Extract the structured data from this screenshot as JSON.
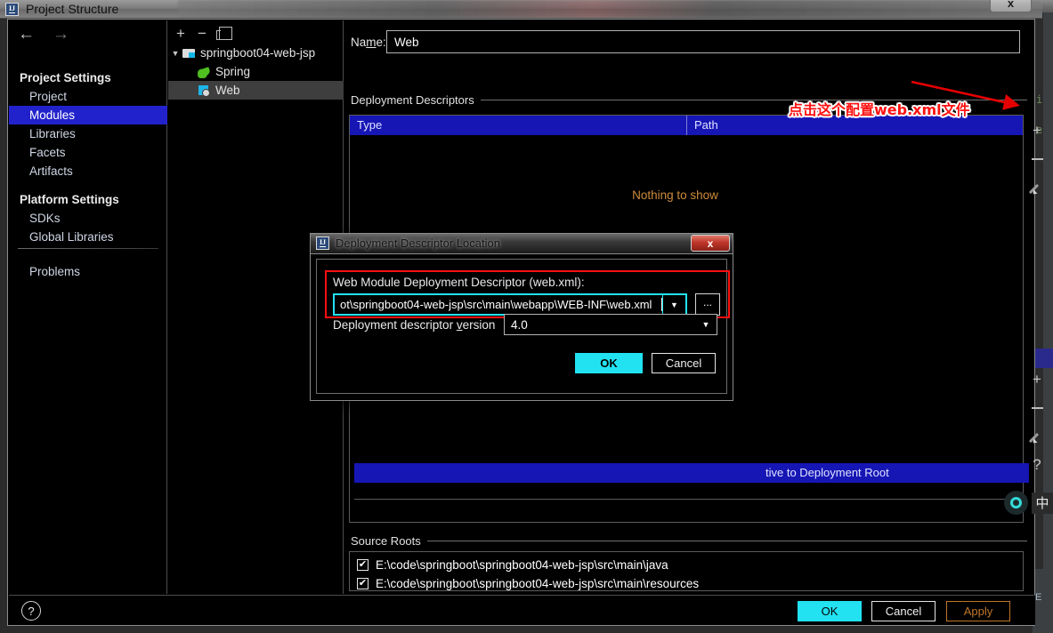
{
  "window": {
    "title": "Project Structure",
    "close_label": "x",
    "logo": "intellij-idea-logo"
  },
  "nav": {
    "back": "←",
    "forward": "→"
  },
  "sidebar": {
    "groups": [
      {
        "title": "Project Settings",
        "items": [
          {
            "label": "Project",
            "selected": false
          },
          {
            "label": "Modules",
            "selected": true
          },
          {
            "label": "Libraries",
            "selected": false
          },
          {
            "label": "Facets",
            "selected": false
          },
          {
            "label": "Artifacts",
            "selected": false
          }
        ]
      },
      {
        "title": "Platform Settings",
        "items": [
          {
            "label": "SDKs",
            "selected": false
          },
          {
            "label": "Global Libraries",
            "selected": false
          }
        ]
      }
    ],
    "problems_label": "Problems"
  },
  "tree_toolbar": {
    "add_label": "+",
    "remove_label": "−",
    "copy_icon": "copy-icon"
  },
  "tree": {
    "root": {
      "label": "springboot04-web-jsp",
      "expander": "▼",
      "icon": "module-folder-icon"
    },
    "children": [
      {
        "label": "Spring",
        "icon": "spring-leaf-icon",
        "selected": false
      },
      {
        "label": "Web",
        "icon": "web-module-icon",
        "selected": true
      }
    ]
  },
  "content": {
    "name_label": "Na",
    "name_label_underlined": "m",
    "name_label_tail": "e:",
    "name_value": "Web",
    "deployment_descriptors_title": "Deployment Descriptors",
    "table": {
      "columns": [
        "Type",
        "Path"
      ],
      "empty_message": "Nothing to show"
    },
    "second_table_header": "tive to Deployment Root",
    "source_roots_title": "Source Roots",
    "source_roots": [
      {
        "path": "E:\\code\\springboot\\springboot04-web-jsp\\src\\main\\java",
        "checked": true
      },
      {
        "path": "E:\\code\\springboot\\springboot04-web-jsp\\src\\main\\resources",
        "checked": true
      }
    ],
    "toolbar_top": [
      {
        "name": "add",
        "label": "+"
      },
      {
        "name": "remove",
        "label": "−"
      },
      {
        "name": "edit",
        "label": "pencil"
      }
    ],
    "toolbar_bottom": [
      {
        "name": "add",
        "label": "+"
      },
      {
        "name": "remove",
        "label": "−"
      },
      {
        "name": "edit",
        "label": "pencil"
      },
      {
        "name": "help",
        "label": "?"
      }
    ]
  },
  "footer": {
    "help_label": "?",
    "ok_label": "OK",
    "cancel_label": "Cancel",
    "apply_label": "Apply"
  },
  "annotation": {
    "text": "点击这个配置web.xml文件",
    "color": "#ff1111",
    "outline_color": "#ffffff",
    "arrow_color": "#e60000"
  },
  "dialog": {
    "title": "Deployment Descriptor Location",
    "close_label": "x",
    "descriptor_label": "Web Module Deployment Descriptor (web.xml):",
    "descriptor_value": "ot\\springboot04-web-jsp\\src\\main\\webapp\\WEB-INF\\web.xml",
    "dropdown_arrow": "▼",
    "browse_label": "...",
    "version_label_head": "Deployment descriptor ",
    "version_label_underlined": "v",
    "version_label_tail": "ersion",
    "version_value": "4.0",
    "ok_label": "OK",
    "cancel_label": "Cancel",
    "highlight_color": "#22e2f2",
    "red_box_color": "#ff0f0f"
  },
  "ime": {
    "mode_icon": "ime-circle-icon",
    "mode_label": "中"
  },
  "background_ide": {
    "code_fragment_1": "i",
    "code_fragment_2": "e",
    "bottom_fragment": "E"
  }
}
